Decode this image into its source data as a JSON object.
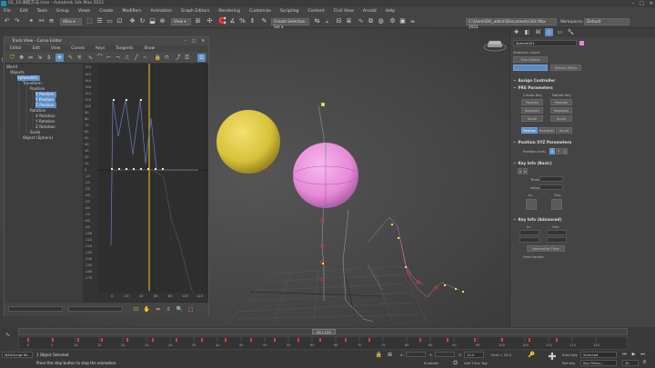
{
  "window": {
    "title": "02_10.采取方法.max - Autodesk 3ds Max 2022"
  },
  "menu": [
    "File",
    "Edit",
    "Tools",
    "Group",
    "Views",
    "Create",
    "Modifiers",
    "Animation",
    "Graph Editors",
    "Rendering",
    "Customize",
    "Scripting",
    "Content",
    "Civil View",
    "Arnold",
    "Help"
  ],
  "toolbar": {
    "filter_value": "Alles",
    "view_value": "View",
    "create_selection_set": "Create Selection Set",
    "project_path": "C:\\Users\\OO_admin\\Documents\\3ds Max 2022",
    "workspaces_label": "Workspaces:",
    "workspaces_value": "Default"
  },
  "viewport": {
    "label": "[+] [Perspective] [Standard] [Default Shading]"
  },
  "track_view": {
    "title": "Track View - Curve Editor",
    "menu": [
      "Editor",
      "Edit",
      "View",
      "Curves",
      "Keys",
      "Tangents",
      "Show"
    ],
    "tree": [
      {
        "label": "World",
        "indent": 0,
        "sel": false
      },
      {
        "label": "Objects",
        "indent": 1,
        "sel": false
      },
      {
        "label": "Sphere001",
        "indent": 2,
        "sel": true
      },
      {
        "label": "Transform",
        "indent": 3,
        "sel": false
      },
      {
        "label": "Position",
        "indent": 4,
        "sel": false
      },
      {
        "label": "X Position",
        "indent": 5,
        "sel": true
      },
      {
        "label": "Y Position",
        "indent": 5,
        "sel": true
      },
      {
        "label": "Z Position",
        "indent": 5,
        "sel": true
      },
      {
        "label": "Rotation",
        "indent": 4,
        "sel": false
      },
      {
        "label": "X Rotation",
        "indent": 5,
        "sel": false
      },
      {
        "label": "Y Rotation",
        "indent": 5,
        "sel": false
      },
      {
        "label": "Z Rotation",
        "indent": 5,
        "sel": false
      },
      {
        "label": "Scale",
        "indent": 4,
        "sel": false
      },
      {
        "label": "Object (Sphere)",
        "indent": 2,
        "sel": false
      }
    ],
    "y_ticks": [
      "175",
      "150",
      "140",
      "130",
      "120",
      "110",
      "100",
      "90",
      "80",
      "70",
      "60",
      "50",
      "40",
      "30",
      "20",
      "10",
      "0",
      "-10",
      "-20",
      "-30",
      "-40",
      "-50",
      "-60",
      "-70",
      "-80",
      "-90",
      "-100",
      "-110",
      "-120",
      "-130",
      "-140",
      "-150",
      "-160",
      "-170"
    ],
    "x_ticks": [
      "0",
      "20",
      "40",
      "60",
      "80",
      "100",
      "120"
    ]
  },
  "command_panel": {
    "object_name": "Sphere001",
    "selection_level": "Selection Level:",
    "sub_object": "Sub-Object",
    "conversions": "Conversions",
    "motion_paths": "Motion Paths",
    "assign_controller": "Assign Controller",
    "prs_parameters": "PRS Parameters",
    "create_key": "Create Key",
    "delete_key": "Delete Key",
    "position": "Position",
    "rotation": "Rotation",
    "scale": "Scale",
    "position_tab": "Position",
    "rotation_tab": "Rotation",
    "scale_tab": "Scale",
    "pos_xyz": "Position XYZ Parameters",
    "position_axis": "Position Axis:",
    "axes": [
      "X",
      "Y",
      "Z"
    ],
    "key_info_basic": "Key Info (Basic)",
    "time": "Time:",
    "value": "Value:",
    "in": "In:",
    "out": "Out:",
    "key_info_adv": "Key Info (Advanced)",
    "normalize_time": "Normalize Time",
    "free_handle": "Free Handle"
  },
  "timeline": {
    "frame": "40 / 120",
    "ticks": [
      "0",
      "5",
      "10",
      "15",
      "20",
      "25",
      "30",
      "35",
      "40",
      "45",
      "50",
      "55",
      "60",
      "65",
      "70",
      "75",
      "80",
      "85",
      "90",
      "95",
      "100",
      "105",
      "110",
      "115",
      "120"
    ]
  },
  "status": {
    "maxscript": "MAXScript Mi...",
    "objects_selected": "1 Object Selected",
    "prompt": "Press the stop button to stop the animation.",
    "x_label": "X:",
    "y_label": "Y:",
    "z_label": "Z:",
    "z_value": "10.0",
    "grid": "Grid = 10.0",
    "add_time_tag": "Add Time Tag",
    "autokey": "Auto Key",
    "selected": "Selected",
    "setkey": "Set Key",
    "key_filters": "Key Filters...",
    "frame_value": "40",
    "enabled_label": "Enabled:"
  },
  "colors": {
    "accent": "#5b8ec5",
    "key_color": "#ea3a3a",
    "sphere_yellow": "#d8c23a",
    "sphere_pink": "#e88ad8"
  }
}
